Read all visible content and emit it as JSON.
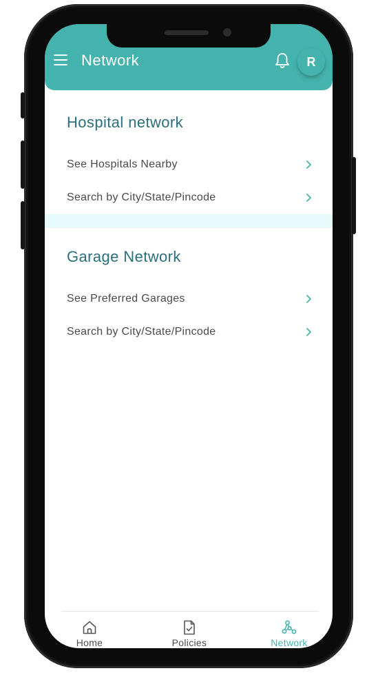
{
  "colors": {
    "accent": "#45b3ad",
    "heading": "#2b6f7d",
    "text": "#4a4a4a",
    "band": "#e8fbfb",
    "frame": "#0b0b0b"
  },
  "appbar": {
    "title": "Network",
    "menu_icon": "hamburger-menu-icon",
    "notification_icon": "bell-icon",
    "avatar_initial": "R"
  },
  "hospital_section": {
    "title": "Hospital network",
    "items": [
      {
        "label": "See Hospitals Nearby",
        "icon": "chevron-right-icon"
      },
      {
        "label": "Search by City/State/Pincode",
        "icon": "chevron-right-icon"
      }
    ]
  },
  "garage_section": {
    "title": "Garage Network",
    "items": [
      {
        "label": "See Preferred Garages",
        "icon": "chevron-right-icon"
      },
      {
        "label": "Search by City/State/Pincode",
        "icon": "chevron-right-icon"
      }
    ]
  },
  "bottom_nav": {
    "items": [
      {
        "label": "Home",
        "icon": "home-icon",
        "active": false
      },
      {
        "label": "Policies",
        "icon": "document-check-icon",
        "active": false
      },
      {
        "label": "Network",
        "icon": "network-nodes-icon",
        "active": true
      }
    ]
  }
}
